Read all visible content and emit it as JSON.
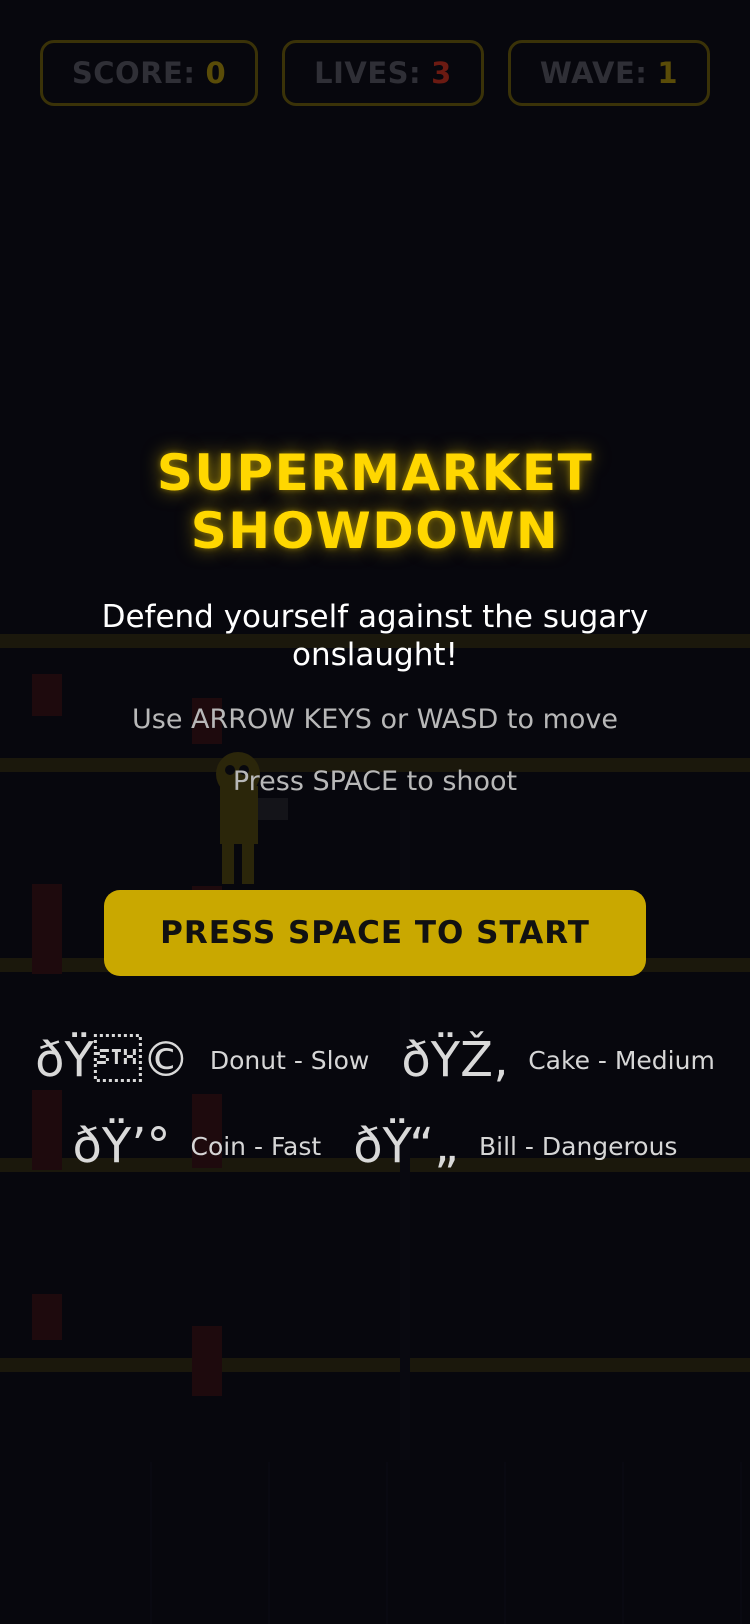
{
  "colors": {
    "accent": "#FFD700",
    "button": "#C9A800",
    "lives_value": "#6b1a12",
    "hud_value": "#5a4c08",
    "instruction_text": "#b8b8b8",
    "tagline_text": "#ffffff"
  },
  "hud": {
    "score_label": "SCORE:",
    "score_value": "0",
    "lives_label": "LIVES:",
    "lives_value": "3",
    "wave_label": "WAVE:",
    "wave_value": "1"
  },
  "menu": {
    "title_line1": "SUPERMARKET",
    "title_line2": "SHOWDOWN",
    "tagline": "Defend yourself against the sugary onslaught!",
    "move_instruction": "Use ARROW KEYS or WASD to move",
    "shoot_instruction": "Press SPACE to shoot",
    "start_button": "PRESS SPACE TO START"
  },
  "legend": [
    {
      "icon": "donut-icon",
      "glyph": "ðŸ\u0002©",
      "label": "Donut - Slow"
    },
    {
      "icon": "cake-icon",
      "glyph": "ðŸŽ‚",
      "label": "Cake - Medium"
    },
    {
      "icon": "coin-icon",
      "glyph": "ðŸ’°",
      "label": "Coin - Fast"
    },
    {
      "icon": "bill-icon",
      "glyph": "ðŸ“„",
      "label": "Bill - Dangerous"
    }
  ]
}
